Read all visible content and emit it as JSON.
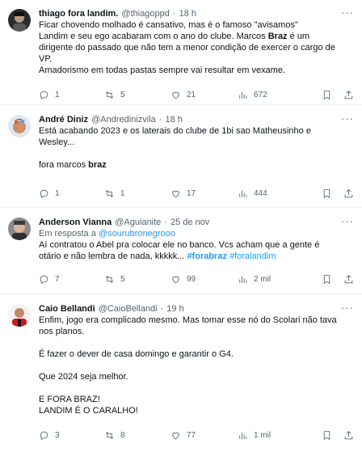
{
  "tweets": [
    {
      "name": "thiago fora landim.",
      "handle": "@thiagoppd",
      "time": "18 h",
      "lines": [
        "Ficar chovendo molhado é cansativo, mas é o famoso \"avisamos\"",
        "Landim e seu ego acabaram com o ano do clube. Marcos ",
        "Braz",
        " é um",
        "dirigente do passado que não tem a menor condição de exercer o cargo de",
        "VP.",
        "Amadorismo em todas pastas sempre vai resultar em vexame."
      ],
      "replies": "1",
      "retweets": "5",
      "likes": "21",
      "views": "672"
    },
    {
      "name": "André Diniz",
      "handle": "@Andredinizvila",
      "time": "18 h",
      "lines": [
        "Está acabando 2023 e os laterais do clube de 1bi sao Matheusinho e",
        "Wesley...",
        "",
        "fora marcos ",
        "braz"
      ],
      "replies": "1",
      "retweets": "1",
      "likes": "17",
      "views": "444"
    },
    {
      "name": "Anderson Vianna",
      "handle": "@Aguianite",
      "time": "25 de nov",
      "reply_prefix": "Em resposta a ",
      "reply_mention": "@sourubronegrooo",
      "lines": [
        "Aí contratou o Abel pra colocar ele no banco. Vcs acham que a gente é",
        "otário e não lembra de nada, kkkkk... ",
        "#forabraz",
        " ",
        "#foralandim"
      ],
      "replies": "7",
      "retweets": "5",
      "likes": "99",
      "views": "2 mil"
    },
    {
      "name": "Caio Bellandi",
      "handle": "@CaioBellandi",
      "time": "19 h",
      "lines": [
        "Enfim, jogo era complicado mesmo. Mas tomar esse nó do Scolari não tava",
        "nos planos.",
        "",
        "É fazer o dever de casa domingo e garantir o G4.",
        "",
        "Que 2024 seja melhor.",
        "",
        "E FORA BRAZ!",
        "LANDIM É O CARALHO!"
      ],
      "replies": "3",
      "retweets": "8",
      "likes": "77",
      "views": "1 mil"
    }
  ],
  "colors": {
    "text": "#0f1419",
    "muted": "#536471",
    "link": "#1d9bf0",
    "divider": "#eff3f4"
  }
}
